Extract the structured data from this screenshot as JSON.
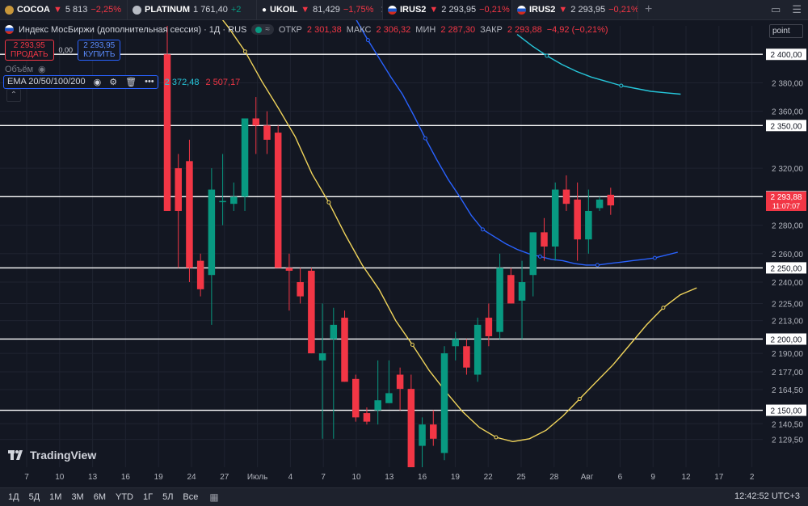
{
  "tabs": [
    {
      "symbol": "COCOA",
      "change_arrow": "▼",
      "price": "5 813",
      "change": "−2,25%",
      "direction": "down",
      "icon": "cocoa-icon",
      "icon_color": "#c8973a",
      "active": false
    },
    {
      "symbol": "PLATINUM",
      "change_arrow": "",
      "price": "1 761,40",
      "change": "+2",
      "direction": "up",
      "icon": "platinum-icon",
      "icon_color": "#b8bcc4",
      "active": false
    },
    {
      "symbol": "UKOIL",
      "change_arrow": "▼",
      "price": "81,429",
      "change": "−1,75%",
      "direction": "down",
      "icon": "oil-drop-icon",
      "icon_color": "#ffffff",
      "active": false
    },
    {
      "symbol": "IRUS2",
      "change_arrow": "▼",
      "price": "2 293,95",
      "change": "−0,21%",
      "direction": "down",
      "icon": "russia-flag-icon",
      "icon_color": "",
      "active": true
    },
    {
      "symbol": "IRUS2",
      "change_arrow": "▼",
      "price": "2 293,95",
      "change": "−0,21%",
      "direction": "down",
      "icon": "russia-flag-icon",
      "icon_color": "",
      "active": false
    }
  ],
  "legend": {
    "title": "Индекс МосБиржи (дополнительная сессия) · 1Д · RUS",
    "open_label": "ОТКР",
    "open": "2 301,38",
    "high_label": "МАКС",
    "high": "2 306,32",
    "low_label": "МИН",
    "low": "2 287,30",
    "close_label": "ЗАКР",
    "close": "2 293,88",
    "change": "−4,92 (−0,21%)"
  },
  "trade": {
    "sell_price": "2 293,95",
    "sell_label": "ПРОДАТЬ",
    "spread": "0,00",
    "buy_price": "2 293,95",
    "buy_label": "КУПИТЬ"
  },
  "volume_label": "Объём",
  "ema": {
    "label": "EMA 20/50/100/200",
    "value1": "2 372,48",
    "value2": "2 507,17"
  },
  "scale_mode": "point",
  "brand": "TradingView",
  "ranges": [
    "1Д",
    "5Д",
    "1М",
    "3М",
    "6М",
    "YTD",
    "1Г",
    "5Л",
    "Все"
  ],
  "clock": "12:42:52 UTC+3",
  "price_axis": {
    "ticks": [
      "2 380,00",
      "2 360,00",
      "2 320,00",
      "2 280,00",
      "2 260,00",
      "2 240,00",
      "2 225,00",
      "2 213,00",
      "2 190,00",
      "2 177,00",
      "2 164,50",
      "2 140,50",
      "2 129,50"
    ],
    "levels": [
      "2 400,00",
      "2 350,00",
      "2 300,00",
      "2 250,00",
      "2 200,00",
      "2 150,00"
    ],
    "current_price": "2 293,88",
    "countdown": "11:07:07"
  },
  "time_axis": {
    "labels": [
      "7",
      "10",
      "13",
      "16",
      "19",
      "24",
      "27",
      "Июль",
      "4",
      "7",
      "10",
      "13",
      "16",
      "19",
      "22",
      "25",
      "28",
      "Авг",
      "6",
      "9",
      "12",
      "17",
      "2"
    ]
  },
  "colors": {
    "up": "#089981",
    "down": "#f23645",
    "ema20": "#f0d45b",
    "ema50": "#2962ff",
    "ema100": "#26c6da",
    "level": "#ffffff"
  },
  "chart_data": {
    "type": "candlestick",
    "y_axis_ticks": [
      {
        "label": "2 400,00",
        "value": 2400
      },
      {
        "label": "2 380,00",
        "value": 2380
      },
      {
        "label": "2 360,00",
        "value": 2360
      },
      {
        "label": "2 350,00",
        "value": 2350
      },
      {
        "label": "2 320,00",
        "value": 2320
      },
      {
        "label": "2 300,00",
        "value": 2300
      },
      {
        "label": "2 280,00",
        "value": 2280
      },
      {
        "label": "2 260,00",
        "value": 2260
      },
      {
        "label": "2 250,00",
        "value": 2250
      },
      {
        "label": "2 240,00",
        "value": 2240
      },
      {
        "label": "2 225,00",
        "value": 2225
      },
      {
        "label": "2 213,00",
        "value": 2213
      },
      {
        "label": "2 200,00",
        "value": 2200
      },
      {
        "label": "2 190,00",
        "value": 2190
      },
      {
        "label": "2 177,00",
        "value": 2177
      },
      {
        "label": "2 164,50",
        "value": 2164.5
      },
      {
        "label": "2 150,00",
        "value": 2150
      },
      {
        "label": "2 140,50",
        "value": 2140.5
      },
      {
        "label": "2 129,50",
        "value": 2129.5
      }
    ],
    "horizontal_levels": [
      2400,
      2350,
      2300,
      2250,
      2200,
      2150
    ],
    "candles": [
      {
        "o": 2400,
        "h": 2420,
        "l": 2290,
        "c": 2290
      },
      {
        "o": 2320,
        "h": 2330,
        "l": 2250,
        "c": 2290
      },
      {
        "o": 2325,
        "h": 2340,
        "l": 2240,
        "c": 2250
      },
      {
        "o": 2255,
        "h": 2260,
        "l": 2230,
        "c": 2235
      },
      {
        "o": 2245,
        "h": 2320,
        "l": 2210,
        "c": 2305
      },
      {
        "o": 2297,
        "h": 2330,
        "l": 2280,
        "c": 2297
      },
      {
        "o": 2295,
        "h": 2310,
        "l": 2290,
        "c": 2300
      },
      {
        "o": 2300,
        "h": 2350,
        "l": 2290,
        "c": 2355
      },
      {
        "o": 2355,
        "h": 2370,
        "l": 2330,
        "c": 2350
      },
      {
        "o": 2350,
        "h": 2360,
        "l": 2330,
        "c": 2340
      },
      {
        "o": 2345,
        "h": 2350,
        "l": 2250,
        "c": 2250
      },
      {
        "o": 2250,
        "h": 2260,
        "l": 2220,
        "c": 2248
      },
      {
        "o": 2240,
        "h": 2250,
        "l": 2225,
        "c": 2230
      },
      {
        "o": 2248,
        "h": 2250,
        "l": 2190,
        "c": 2190
      },
      {
        "o": 2185,
        "h": 2225,
        "l": 2130,
        "c": 2190
      },
      {
        "o": 2200,
        "h": 2222,
        "l": 2130,
        "c": 2210
      },
      {
        "o": 2215,
        "h": 2220,
        "l": 2170,
        "c": 2170
      },
      {
        "o": 2172,
        "h": 2175,
        "l": 2142,
        "c": 2145
      },
      {
        "o": 2148,
        "h": 2152,
        "l": 2140,
        "c": 2142
      },
      {
        "o": 2150,
        "h": 2185,
        "l": 2140,
        "c": 2157
      },
      {
        "o": 2155,
        "h": 2185,
        "l": 2155,
        "c": 2162
      },
      {
        "o": 2175,
        "h": 2180,
        "l": 2150,
        "c": 2165
      },
      {
        "o": 2165,
        "h": 2175,
        "l": 2110,
        "c": 2110
      },
      {
        "o": 2125,
        "h": 2145,
        "l": 2110,
        "c": 2140
      },
      {
        "o": 2140,
        "h": 2150,
        "l": 2125,
        "c": 2130
      },
      {
        "o": 2120,
        "h": 2195,
        "l": 2115,
        "c": 2190
      },
      {
        "o": 2195,
        "h": 2205,
        "l": 2185,
        "c": 2200
      },
      {
        "o": 2195,
        "h": 2200,
        "l": 2175,
        "c": 2180
      },
      {
        "o": 2175,
        "h": 2215,
        "l": 2170,
        "c": 2210
      },
      {
        "o": 2215,
        "h": 2225,
        "l": 2195,
        "c": 2202
      },
      {
        "o": 2205,
        "h": 2260,
        "l": 2200,
        "c": 2250
      },
      {
        "o": 2245,
        "h": 2250,
        "l": 2225,
        "c": 2225
      },
      {
        "o": 2227,
        "h": 2255,
        "l": 2200,
        "c": 2240
      },
      {
        "o": 2245,
        "h": 2275,
        "l": 2230,
        "c": 2275
      },
      {
        "o": 2275,
        "h": 2285,
        "l": 2255,
        "c": 2265
      },
      {
        "o": 2265,
        "h": 2310,
        "l": 2255,
        "c": 2305
      },
      {
        "o": 2305,
        "h": 2315,
        "l": 2290,
        "c": 2295
      },
      {
        "o": 2298,
        "h": 2310,
        "l": 2255,
        "c": 2270
      },
      {
        "o": 2270,
        "h": 2305,
        "l": 2260,
        "c": 2290
      },
      {
        "o": 2292,
        "h": 2300,
        "l": 2290,
        "c": 2298
      },
      {
        "o": 2301.38,
        "h": 2306.32,
        "l": 2287.3,
        "c": 2293.88
      }
    ],
    "ema20": [
      2434,
      2419,
      2402,
      2381,
      2362,
      2342,
      2316,
      2296,
      2273,
      2252,
      2235,
      2213,
      2196,
      2178,
      2163,
      2149,
      2138,
      2131,
      2128,
      2130,
      2136,
      2146,
      2158,
      2170,
      2182,
      2196,
      2210,
      2222,
      2231,
      2236
    ],
    "ema50": [
      2437,
      2424,
      2410,
      2397,
      2384,
      2372,
      2357,
      2341,
      2326,
      2312,
      2300,
      2287,
      2277,
      2272,
      2267,
      2263,
      2260,
      2258,
      2256,
      2255,
      2253,
      2252,
      2252,
      2253,
      2254,
      2255,
      2256,
      2257,
      2259,
      2261
    ],
    "ema100": [
      2414,
      2406,
      2399,
      2393,
      2388,
      2384,
      2381,
      2378,
      2376,
      2374,
      2373,
      2372
    ],
    "y_range": [
      2110,
      2420
    ]
  }
}
